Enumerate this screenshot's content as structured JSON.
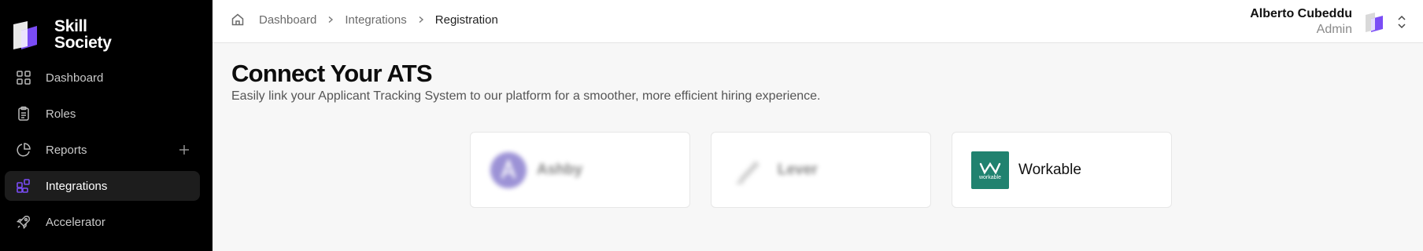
{
  "brand": {
    "name_line1": "Skill",
    "name_line2": "Society"
  },
  "sidebar": {
    "items": [
      {
        "label": "Dashboard",
        "icon": "grid-icon",
        "active": false
      },
      {
        "label": "Roles",
        "icon": "clipboard-icon",
        "active": false
      },
      {
        "label": "Reports",
        "icon": "pie-chart-icon",
        "active": false,
        "has_plus": true
      },
      {
        "label": "Integrations",
        "icon": "integrations-icon",
        "active": true
      },
      {
        "label": "Accelerator",
        "icon": "rocket-icon",
        "active": false
      }
    ]
  },
  "breadcrumb": {
    "items": [
      "Dashboard",
      "Integrations",
      "Registration"
    ]
  },
  "user": {
    "name": "Alberto Cubeddu",
    "role": "Admin"
  },
  "page": {
    "title": "Connect Your ATS",
    "subtitle": "Easily link your Applicant Tracking System to our platform for a smoother, more efficient hiring experience."
  },
  "integrations": [
    {
      "name": "Ashby",
      "logo": "ashby-logo",
      "enabled": false
    },
    {
      "name": "Lever",
      "logo": "lever-logo",
      "enabled": false
    },
    {
      "name": "Workable",
      "logo": "workable-logo",
      "enabled": true,
      "logo_text": "workable"
    }
  ],
  "colors": {
    "accent": "#7a4cf5",
    "sidebar_bg": "#000000",
    "workable_green": "#20826f",
    "ashby_purple": "#4c3ab5"
  }
}
